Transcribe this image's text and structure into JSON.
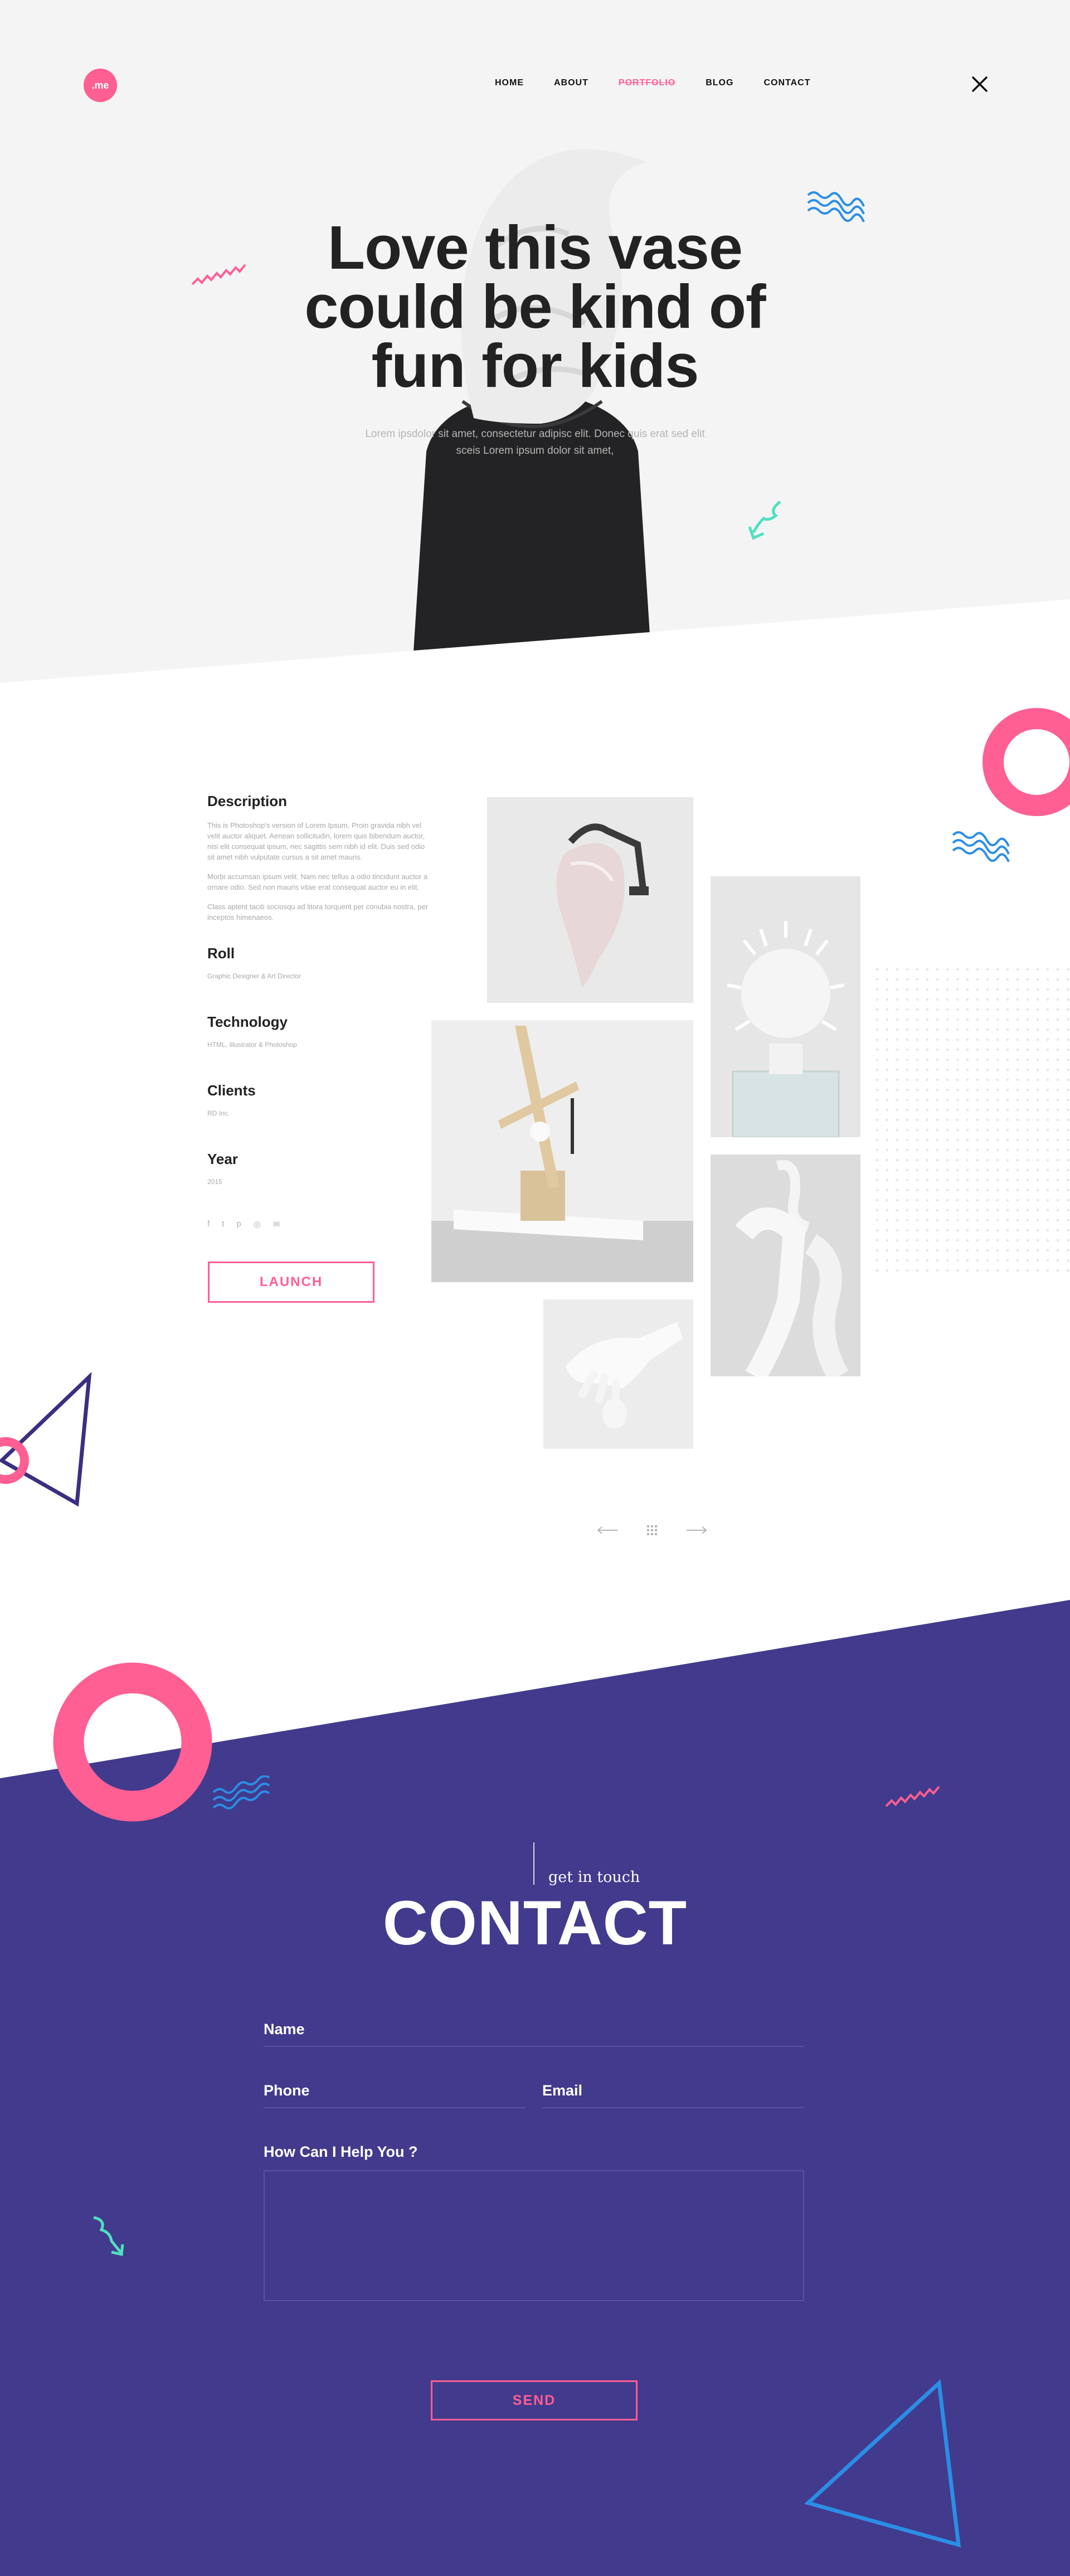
{
  "header": {
    "logo": ".me",
    "nav": [
      "HOME",
      "ABOUT",
      "PORTFOLIO",
      "BLOG",
      "CONTACT"
    ],
    "active_nav": "PORTFOLIO"
  },
  "hero": {
    "title_lines": [
      "Love this vase",
      "could be kind of",
      "fun for kids"
    ],
    "subtitle_lines": [
      "Lorem ipsdolor sit amet, consectetur adipisc elit. Donec quis erat sed elit",
      "sceis Lorem ipsum dolor sit amet,"
    ]
  },
  "details": {
    "description_heading": "Description",
    "description_paragraphs": [
      "This is Photoshop's version of Lorem Ipsum. Proin gravida nibh vel velit auctor aliquet. Aenean sollicitudin, lorem quis bibendum auctor, nisi elit consequat ipsum, nec sagittis sem nibh id elit. Duis sed odio sit amet nibh vulputate cursus a sit amet mauris.",
      "Morbi accumsan ipsum velit. Nam nec tellus a odio tincidunt auctor a ornare odio. Sed non mauris vitae erat consequat auctor eu in elit.",
      "Class aptent taciti sociosqu ad litora torquent per conubia nostra, per inceptos himenaeos."
    ],
    "roll_heading": "Roll",
    "roll_value": "Graphic Designer & Art Director",
    "technology_heading": "Technology",
    "technology_value": "HTML, Illustrator & Photoshop",
    "clients_heading": "Clients",
    "clients_value": "RD Inc.",
    "year_heading": "Year",
    "year_value": "2015",
    "social_icons": [
      "facebook-icon",
      "twitter-icon",
      "pinterest-icon",
      "instagram-icon",
      "mail-icon"
    ],
    "launch_label": "LAUNCH"
  },
  "gallery": {
    "items": [
      "vase-clamp-image",
      "spiky-bust-image",
      "wood-sculpture-image",
      "face-hands-image",
      "hand-egg-image"
    ]
  },
  "pager": {
    "icons": [
      "arrow-left-icon",
      "grid-icon",
      "arrow-right-icon"
    ]
  },
  "contact": {
    "subtitle": "get in touch",
    "title": "CONTACT",
    "name_label": "Name",
    "phone_label": "Phone",
    "email_label": "Email",
    "message_label": "How Can I Help You ?",
    "send_label": "SEND"
  },
  "colors": {
    "accent_pink": "#ff5f92",
    "contact_purple": "#423a8c",
    "deco_blue": "#2b8ee6",
    "deco_teal": "#4fe0c0",
    "triangle_purple": "#3a2f80"
  }
}
